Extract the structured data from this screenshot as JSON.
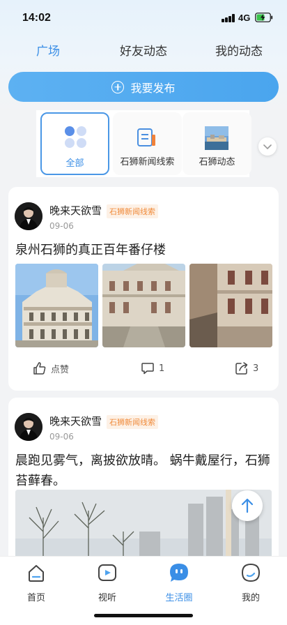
{
  "status": {
    "time": "14:02",
    "network": "4G"
  },
  "tabs": [
    {
      "label": "广场",
      "active": true
    },
    {
      "label": "好友动态",
      "active": false
    },
    {
      "label": "我的动态",
      "active": false
    }
  ],
  "publish": {
    "label": "我要发布"
  },
  "categories": [
    {
      "label": "全部",
      "icon": "grid-icon",
      "active": true
    },
    {
      "label": "石狮新闻线索",
      "icon": "document-icon",
      "active": false
    },
    {
      "label": "石狮动态",
      "icon": "thumbnail-image",
      "active": false
    }
  ],
  "posts": [
    {
      "author": "晚来天欲雪",
      "tag": "石狮新闻线索",
      "date": "09-06",
      "text": "泉州石狮的真正百年番仔楼",
      "like_label": "点赞",
      "comments": "1",
      "shares": "3"
    },
    {
      "author": "晚来天欲雪",
      "tag": "石狮新闻线索",
      "date": "09-06",
      "text": "晨跑见雾气，离披欲放晴。 蜗牛戴屋行，石狮苔藓春。"
    }
  ],
  "bottom_nav": [
    {
      "label": "首页",
      "active": false
    },
    {
      "label": "视听",
      "active": false
    },
    {
      "label": "生活圈",
      "active": true
    },
    {
      "label": "我的",
      "active": false
    }
  ],
  "colors": {
    "accent": "#3a8ee6",
    "tag_text": "#f08a3a",
    "tag_bg": "#fdf1e6"
  }
}
